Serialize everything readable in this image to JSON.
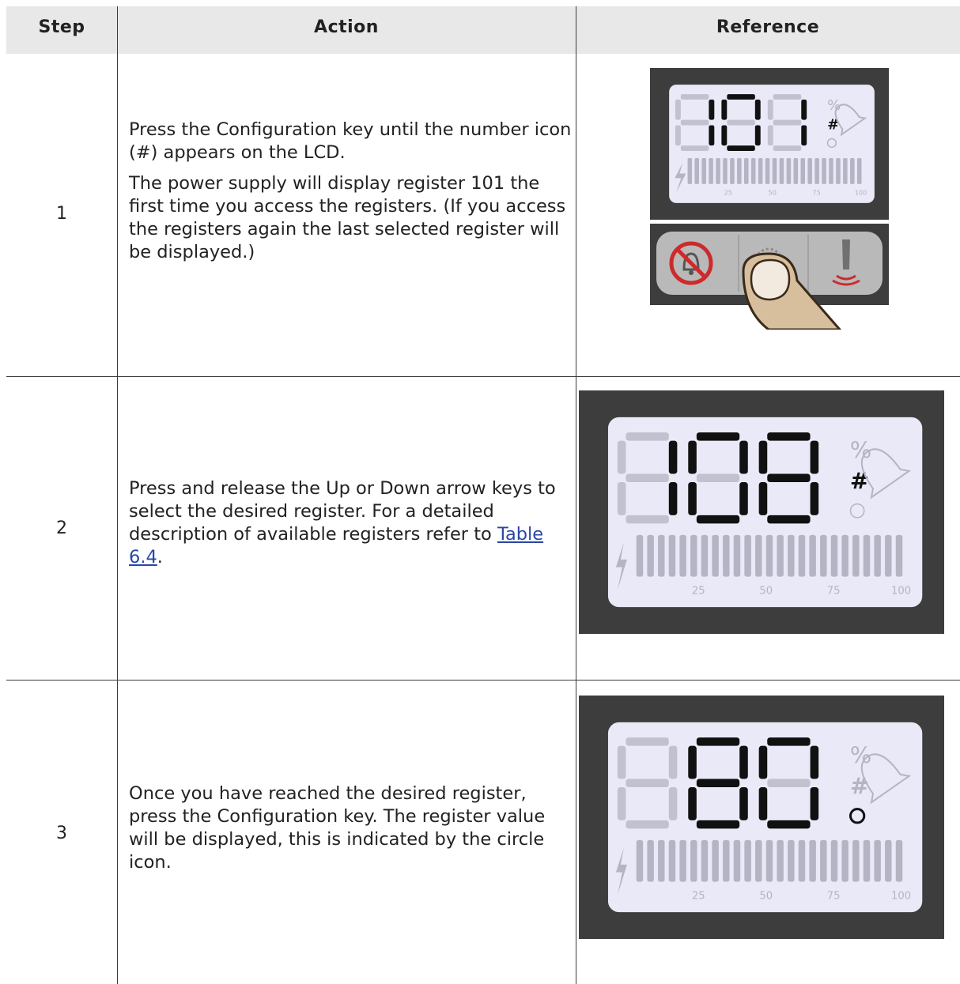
{
  "headers": {
    "step": "Step",
    "action": "Action",
    "reference": "Reference"
  },
  "rows": [
    {
      "step": "1",
      "paragraphs": [
        "Press the Configuration key until the number icon (#) appears on the LCD.",
        "The power supply will display register 101 the first time you access the registers. (If you access the registers again the last selected register will be displayed.)"
      ],
      "lcd": {
        "digits": "101",
        "active_icon": "#"
      }
    },
    {
      "step": "2",
      "text_before_link": "Press and release the Up or Down arrow keys to select the desired register. For a detailed description of available registers refer to ",
      "link_text": "Table 6.4",
      "text_after_link": ".",
      "lcd": {
        "digits": "108",
        "active_icon": "#"
      }
    },
    {
      "step": "3",
      "paragraphs": [
        "Once you have reached the desired register, press the Configuration key. The register value will be displayed, this is indicated by the circle icon."
      ],
      "lcd": {
        "digits": "80",
        "active_icon": "circle"
      }
    }
  ],
  "scale_labels": [
    "25",
    "50",
    "75",
    "100"
  ],
  "colors": {
    "header_bg": "#e8e8e8",
    "lcd_frame": "#3d3d3d",
    "lcd_screen": "#eae9f7",
    "link": "#2a47a6"
  }
}
